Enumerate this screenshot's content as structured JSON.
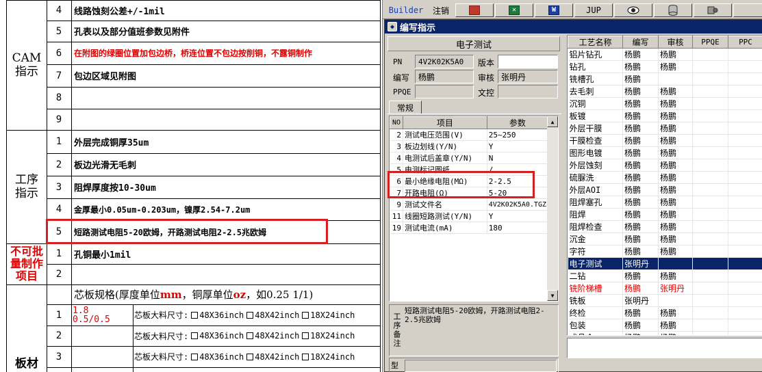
{
  "doc": {
    "sections": {
      "cam": "CAM\n指示",
      "process": "工序\n指示",
      "no_batch": "不可批\n量制作\n项目",
      "board": "板材"
    },
    "cam_rows": [
      {
        "no": "4",
        "text": "线路蚀刻公差+/-1mil"
      },
      {
        "no": "5",
        "text": "孔表以及部分值班参数见附件"
      },
      {
        "no": "6",
        "text": "在附图的绿圈位置加包边桥，桥连位置不包边按削铜，不露铜制作"
      },
      {
        "no": "7",
        "text": "包边区域见附图"
      },
      {
        "no": "8",
        "text": ""
      },
      {
        "no": "9",
        "text": ""
      }
    ],
    "process_rows": [
      {
        "no": "1",
        "text": "外层完成铜厚35um"
      },
      {
        "no": "2",
        "text": "板边光滑无毛刺"
      },
      {
        "no": "3",
        "text": "阻焊厚度按10-30um"
      },
      {
        "no": "4",
        "text": "金厚最小0.05um-0.203um，镍厚2.54-7.2um"
      },
      {
        "no": "5",
        "text": "短路测试电阻5-20欧姆，开路测试电阻2-2.5兆欧姆"
      }
    ],
    "batch_rows": [
      {
        "no": "1",
        "text": "孔铜最小1mil"
      },
      {
        "no": "2",
        "text": ""
      }
    ],
    "core_header": {
      "part1": "芯板规格(厚度单位",
      "unit1": "mm",
      "part2": "，铜厚单位",
      "unit2": "oz",
      "part3": "，如0.25 1/1)"
    },
    "core_rows": [
      {
        "no": "1",
        "spec": "1.8\n0.5/0.5",
        "label": "芯板大料尺寸:",
        "opt1": "48X36inch",
        "opt2": "48X42inch",
        "opt3": "18X24inch"
      },
      {
        "no": "2",
        "spec": "",
        "label": "芯板大料尺寸:",
        "opt1": "48X36inch",
        "opt2": "48X42inch",
        "opt3": "18X24inch"
      },
      {
        "no": "3",
        "spec": "",
        "label": "芯板大料尺寸:",
        "opt1": "48X36inch",
        "opt2": "48X42inch",
        "opt3": "18X24inch"
      }
    ]
  },
  "toolbar": {
    "builder": "Builder",
    "logout": "注销",
    "jup": "JUP"
  },
  "dialog": {
    "title": "编写指示",
    "section_title": "电子测试",
    "pn_label": "PN",
    "pn_value": "4V2K02K5A0",
    "version_label": "版本",
    "version_value": "",
    "writer_label": "编写",
    "writer_value": "杨鹏",
    "reviewer_label": "审核",
    "reviewer_value": "张明丹",
    "ppqe_label": "PPQE",
    "ppqe_value": "",
    "control_label": "文控",
    "control_value": "",
    "tab_label": "常规",
    "param_headers": [
      "NO",
      "项目",
      "参数"
    ],
    "params": [
      {
        "no": "2",
        "item": "测试电压范围(V)",
        "value": "25~250"
      },
      {
        "no": "3",
        "item": "板边划线(Y/N)",
        "value": "Y"
      },
      {
        "no": "4",
        "item": "电测试后盖章(Y/N)",
        "value": "N"
      },
      {
        "no": "5",
        "item": "电测标记图纸",
        "value": "/"
      },
      {
        "no": "6",
        "item": "最小绝缘电阻(MΩ)",
        "value": "2-2.5"
      },
      {
        "no": "7",
        "item": "开路电阻(Ω)",
        "value": "5-20"
      },
      {
        "no": "9",
        "item": "测试文件名",
        "value": "4V2K02K5A0.TGZ"
      },
      {
        "no": "11",
        "item": "线圈短路测试(Y/N)",
        "value": "Y"
      },
      {
        "no": "19",
        "item": "测试电流(mA)",
        "value": "180"
      }
    ],
    "note_label": "工序备注",
    "note_text": "短路测试电阻5-20欧姆，开路测试电阻2-2.5兆欧姆",
    "bottom_label": "型"
  },
  "process_list": {
    "headers": [
      "工艺名称",
      "编写",
      "审核",
      "PPQE",
      "PPC"
    ],
    "rows": [
      {
        "name": "铝片钻孔",
        "writer": "杨鹏",
        "reviewer": "杨鹏",
        "ppqe": "",
        "ppc": "",
        "style": ""
      },
      {
        "name": "钻孔",
        "writer": "杨鹏",
        "reviewer": "杨鹏",
        "ppqe": "",
        "ppc": "",
        "style": ""
      },
      {
        "name": "铣槽孔",
        "writer": "杨鹏",
        "reviewer": "",
        "ppqe": "",
        "ppc": "",
        "style": ""
      },
      {
        "name": "去毛刺",
        "writer": "杨鹏",
        "reviewer": "杨鹏",
        "ppqe": "",
        "ppc": "",
        "style": ""
      },
      {
        "name": "沉铜",
        "writer": "杨鹏",
        "reviewer": "杨鹏",
        "ppqe": "",
        "ppc": "",
        "style": ""
      },
      {
        "name": "板镀",
        "writer": "杨鹏",
        "reviewer": "杨鹏",
        "ppqe": "",
        "ppc": "",
        "style": ""
      },
      {
        "name": "外层干膜",
        "writer": "杨鹏",
        "reviewer": "杨鹏",
        "ppqe": "",
        "ppc": "",
        "style": ""
      },
      {
        "name": "干膜检查",
        "writer": "杨鹏",
        "reviewer": "杨鹏",
        "ppqe": "",
        "ppc": "",
        "style": ""
      },
      {
        "name": "图形电镀",
        "writer": "杨鹏",
        "reviewer": "杨鹏",
        "ppqe": "",
        "ppc": "",
        "style": ""
      },
      {
        "name": "外层蚀刻",
        "writer": "杨鹏",
        "reviewer": "杨鹏",
        "ppqe": "",
        "ppc": "",
        "style": ""
      },
      {
        "name": "硫脲洗",
        "writer": "杨鹏",
        "reviewer": "杨鹏",
        "ppqe": "",
        "ppc": "",
        "style": ""
      },
      {
        "name": "外层AOI",
        "writer": "杨鹏",
        "reviewer": "杨鹏",
        "ppqe": "",
        "ppc": "",
        "style": ""
      },
      {
        "name": "阻焊塞孔",
        "writer": "杨鹏",
        "reviewer": "杨鹏",
        "ppqe": "",
        "ppc": "",
        "style": ""
      },
      {
        "name": "阻焊",
        "writer": "杨鹏",
        "reviewer": "杨鹏",
        "ppqe": "",
        "ppc": "",
        "style": ""
      },
      {
        "name": "阻焊检查",
        "writer": "杨鹏",
        "reviewer": "杨鹏",
        "ppqe": "",
        "ppc": "",
        "style": ""
      },
      {
        "name": "沉金",
        "writer": "杨鹏",
        "reviewer": "杨鹏",
        "ppqe": "",
        "ppc": "",
        "style": ""
      },
      {
        "name": "字符",
        "writer": "杨鹏",
        "reviewer": "杨鹏",
        "ppqe": "",
        "ppc": "",
        "style": ""
      },
      {
        "name": "电子测试",
        "writer": "张明丹",
        "reviewer": "",
        "ppqe": "",
        "ppc": "",
        "style": "selected"
      },
      {
        "name": "二钻",
        "writer": "杨鹏",
        "reviewer": "杨鹏",
        "ppqe": "",
        "ppc": "",
        "style": ""
      },
      {
        "name": "铣阶梯槽",
        "writer": "杨鹏",
        "reviewer": "张明丹",
        "ppqe": "",
        "ppc": "",
        "style": "red"
      },
      {
        "name": "铣板",
        "writer": "张明丹",
        "reviewer": "",
        "ppqe": "",
        "ppc": "",
        "style": ""
      },
      {
        "name": "终检",
        "writer": "杨鹏",
        "reviewer": "杨鹏",
        "ppqe": "",
        "ppc": "",
        "style": ""
      },
      {
        "name": "包装",
        "writer": "杨鹏",
        "reviewer": "杨鹏",
        "ppqe": "",
        "ppc": "",
        "style": ""
      },
      {
        "name": "成品仓",
        "writer": "杨鹏",
        "reviewer": "杨鹏",
        "ppqe": "",
        "ppc": "",
        "style": ""
      }
    ]
  },
  "colors": {
    "highlight": "#d61f1f",
    "selected_bg": "#0a246a",
    "red_text": "#e00000"
  }
}
